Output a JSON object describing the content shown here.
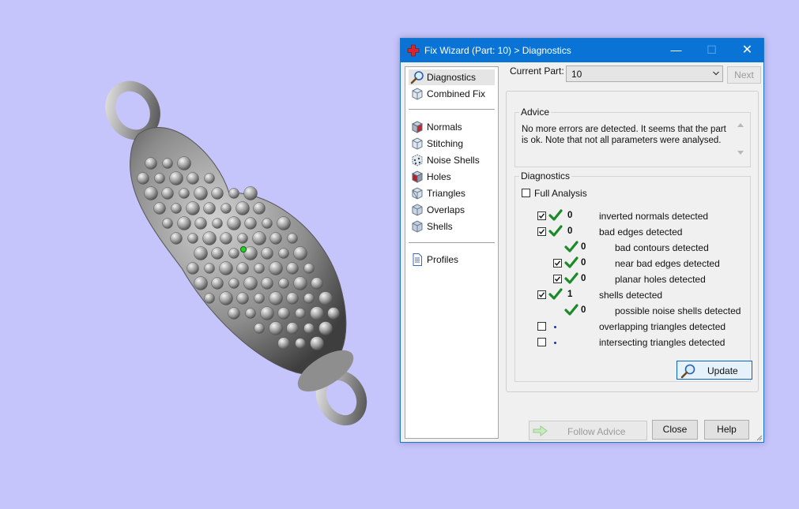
{
  "window": {
    "title": "Fix Wizard (Part: 10) > Diagnostics",
    "minimize_glyph": "—",
    "maximize_glyph": "☐",
    "close_glyph": "✕"
  },
  "nav": {
    "items": [
      {
        "label": "Diagnostics",
        "icon": "magnifier-icon"
      },
      {
        "label": "Combined Fix",
        "icon": "cube-icon"
      },
      {
        "label": "Normals",
        "icon": "cube-red-face-icon"
      },
      {
        "label": "Stitching",
        "icon": "cube-icon"
      },
      {
        "label": "Noise Shells",
        "icon": "dotted-cube-icon"
      },
      {
        "label": "Holes",
        "icon": "cube-red-face-icon"
      },
      {
        "label": "Triangles",
        "icon": "cube-triangle-icon"
      },
      {
        "label": "Overlaps",
        "icon": "cube-icon"
      },
      {
        "label": "Shells",
        "icon": "cube-icon"
      },
      {
        "label": "Profiles",
        "icon": "document-icon"
      }
    ]
  },
  "current_part": {
    "label": "Current Part:",
    "value": "10",
    "next_label": "Next"
  },
  "advice": {
    "group_label": "Advice",
    "text": "No more errors are detected. It seems that the part is ok. Note that not all parameters were analysed."
  },
  "diagnostics": {
    "group_label": "Diagnostics",
    "full_analysis_label": "Full Analysis",
    "full_analysis_checked": false,
    "rows": [
      {
        "checked": true,
        "status": "ok",
        "count": "0",
        "label": "inverted normals detected"
      },
      {
        "checked": true,
        "status": "ok",
        "count": "0",
        "label": "bad edges detected"
      },
      {
        "checked": null,
        "status": "ok",
        "count": "0",
        "label": "bad contours detected"
      },
      {
        "checked": true,
        "status": "ok",
        "count": "0",
        "label": "near bad edges detected"
      },
      {
        "checked": true,
        "status": "ok",
        "count": "0",
        "label": "planar holes detected"
      },
      {
        "checked": true,
        "status": "ok",
        "count": "1",
        "label": "shells detected"
      },
      {
        "checked": null,
        "status": "ok",
        "count": "0",
        "label": "possible noise shells detected"
      },
      {
        "checked": false,
        "status": "pending",
        "count": "",
        "label": "overlapping triangles detected"
      },
      {
        "checked": false,
        "status": "pending",
        "count": "",
        "label": "intersecting triangles detected"
      }
    ],
    "update_label": "Update"
  },
  "footer": {
    "follow_advice_label": "Follow Advice",
    "close_label": "Close",
    "help_label": "Help"
  },
  "colors": {
    "background": "#c5c4fb",
    "titlebar": "#0a74d6",
    "check_green": "#1d8a2a",
    "model_gray": "#9a9a9a"
  }
}
